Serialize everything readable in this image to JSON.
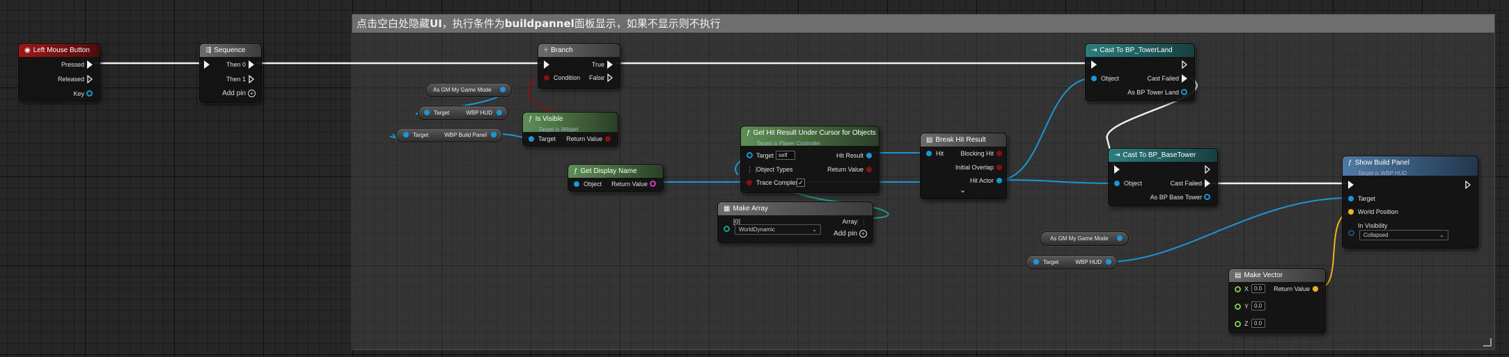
{
  "comment": {
    "prefix": "点击空白处隐藏",
    "ui": "UI",
    "mid": "，执行条件为",
    "bold": "buildpannel",
    "suffix": "面板显示，如果不显示则不执行"
  },
  "colors": {
    "exec": "#f0f0f0",
    "object": "#1b96d6",
    "bool": "#8a0f0f",
    "vector": "#f0b41e",
    "string": "#d63ac4",
    "event_header": "#a01717",
    "pure_header": "#5e8f55",
    "cast_header": "#2c7d7d",
    "func_header": "#4f7aa6"
  },
  "nodes": {
    "left_mouse": {
      "title": "Left Mouse Button",
      "icon": "mouse-icon",
      "pressed": "Pressed",
      "released": "Released",
      "key": "Key"
    },
    "sequence": {
      "title": "Sequence",
      "icon": "sequence-icon",
      "then0": "Then 0",
      "then1": "Then 1",
      "add_pin": "Add pin"
    },
    "branch": {
      "title": "Branch",
      "icon": "branch-icon",
      "condition": "Condition",
      "true": "True",
      "false": "False"
    },
    "is_visible": {
      "title": "Is Visible",
      "subtitle": "Target is Widget",
      "target": "Target",
      "return": "Return Value"
    },
    "get_display_name": {
      "title": "Get Display Name",
      "object": "Object",
      "return": "Return Value"
    },
    "get_hit_result": {
      "title": "Get Hit Result Under Cursor for Objects",
      "subtitle": "Target is Player Controller",
      "target": "Target",
      "target_value": "self",
      "object_types": "Object Types",
      "trace_complex": "Trace Complex",
      "trace_checked": "✓",
      "hit_result": "Hit Result",
      "return": "Return Value"
    },
    "make_array": {
      "title": "Make Array",
      "index": "[0]",
      "array": "Array",
      "option": "WorldDynamic",
      "add_pin": "Add pin"
    },
    "break_hit": {
      "title": "Break Hit Result",
      "hit": "Hit",
      "blocking": "Blocking Hit",
      "overlap": "Initial Overlap",
      "actor": "Hit Actor",
      "expand": "⌄"
    },
    "cast_tower_land": {
      "title": "Cast To BP_TowerLand",
      "object": "Object",
      "failed": "Cast Failed",
      "as": "As BP Tower Land"
    },
    "cast_base_tower": {
      "title": "Cast To BP_BaseTower",
      "object": "Object",
      "failed": "Cast Failed",
      "as": "As BP Base Tower"
    },
    "show_build": {
      "title": "Show Build Panel",
      "subtitle": "Target is WBP HUD",
      "target": "Target",
      "world_pos": "World Position",
      "visibility": "In Visibility",
      "visibility_value": "Collapsed"
    },
    "make_vector": {
      "title": "Make Vector",
      "x": "X",
      "y": "Y",
      "z": "Z",
      "x_val": "0.0",
      "y_val": "0.0",
      "z_val": "0.0",
      "return": "Return Value"
    }
  },
  "vars": {
    "gm1": "As GM My Game Mode",
    "target1": "Target",
    "hud1": "WBP HUD",
    "target2": "Target",
    "build_panel": "WBP Build Panel",
    "gm2": "As GM My Game Mode",
    "target3": "Target",
    "hud2": "WBP HUD"
  }
}
